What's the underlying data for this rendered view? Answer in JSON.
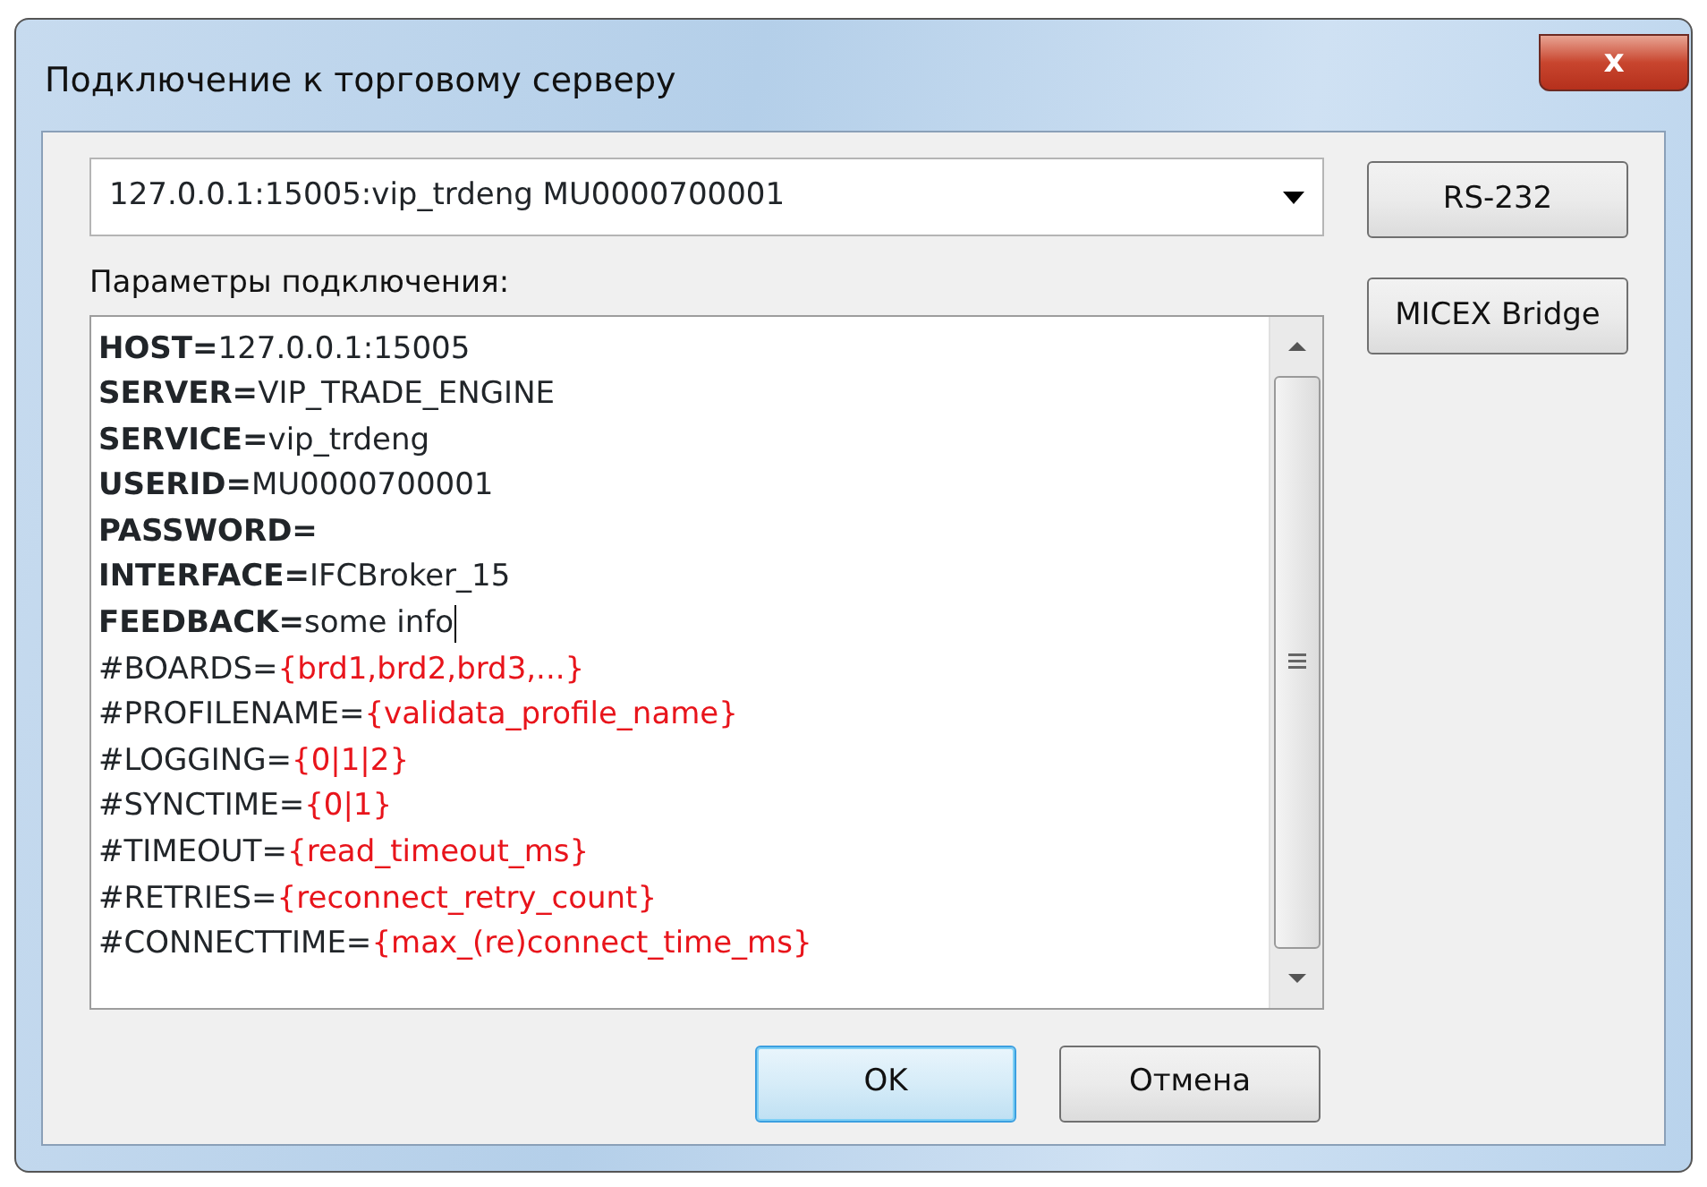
{
  "window": {
    "title": "Подключение к торговому серверу",
    "close_label": "x"
  },
  "server_select": {
    "value": "127.0.0.1:15005:vip_trdeng MU0000700001"
  },
  "params_label": "Параметры подключения:",
  "params_lines": [
    {
      "kind": "param",
      "key": "HOST=",
      "value": "127.0.0.1:15005",
      "cursor": false
    },
    {
      "kind": "param",
      "key": "SERVER=",
      "value": "VIP_TRADE_ENGINE",
      "cursor": false
    },
    {
      "kind": "param",
      "key": "SERVICE=",
      "value": "vip_trdeng",
      "cursor": false
    },
    {
      "kind": "param",
      "key": "USERID=",
      "value": "MU0000700001",
      "cursor": false
    },
    {
      "kind": "param",
      "key": "PASSWORD=",
      "cursor": false
    },
    {
      "kind": "param",
      "key": "INTERFACE=",
      "value": "IFCBroker_15",
      "cursor": false
    },
    {
      "kind": "param",
      "key": "FEEDBACK=",
      "value": "some info",
      "cursor": true
    },
    {
      "kind": "comment",
      "key": "#BOARDS=",
      "value": "{brd1,brd2,brd3,...}",
      "cursor": false
    },
    {
      "kind": "comment",
      "key": "#PROFILENAME=",
      "value": "{validata_profile_name}",
      "cursor": false
    },
    {
      "kind": "comment",
      "key": "#LOGGING=",
      "value": "{0|1|2}",
      "cursor": false
    },
    {
      "kind": "comment",
      "key": "#SYNCTIME=",
      "value": "{0|1}",
      "cursor": false
    },
    {
      "kind": "comment",
      "key": "#TIMEOUT=",
      "value": "{read_timeout_ms}",
      "cursor": false
    },
    {
      "kind": "comment",
      "key": "#RETRIES=",
      "value": "{reconnect_retry_count}",
      "cursor": false
    },
    {
      "kind": "comment",
      "key": "#CONNECTTIME=",
      "value": "{max_(re)connect_time_ms}",
      "cursor": false
    }
  ],
  "side_buttons": [
    "RS-232",
    "MICEX Bridge"
  ],
  "buttons": [
    {
      "label": "OK",
      "default": true
    },
    {
      "label": "Отмена",
      "default": false
    }
  ]
}
